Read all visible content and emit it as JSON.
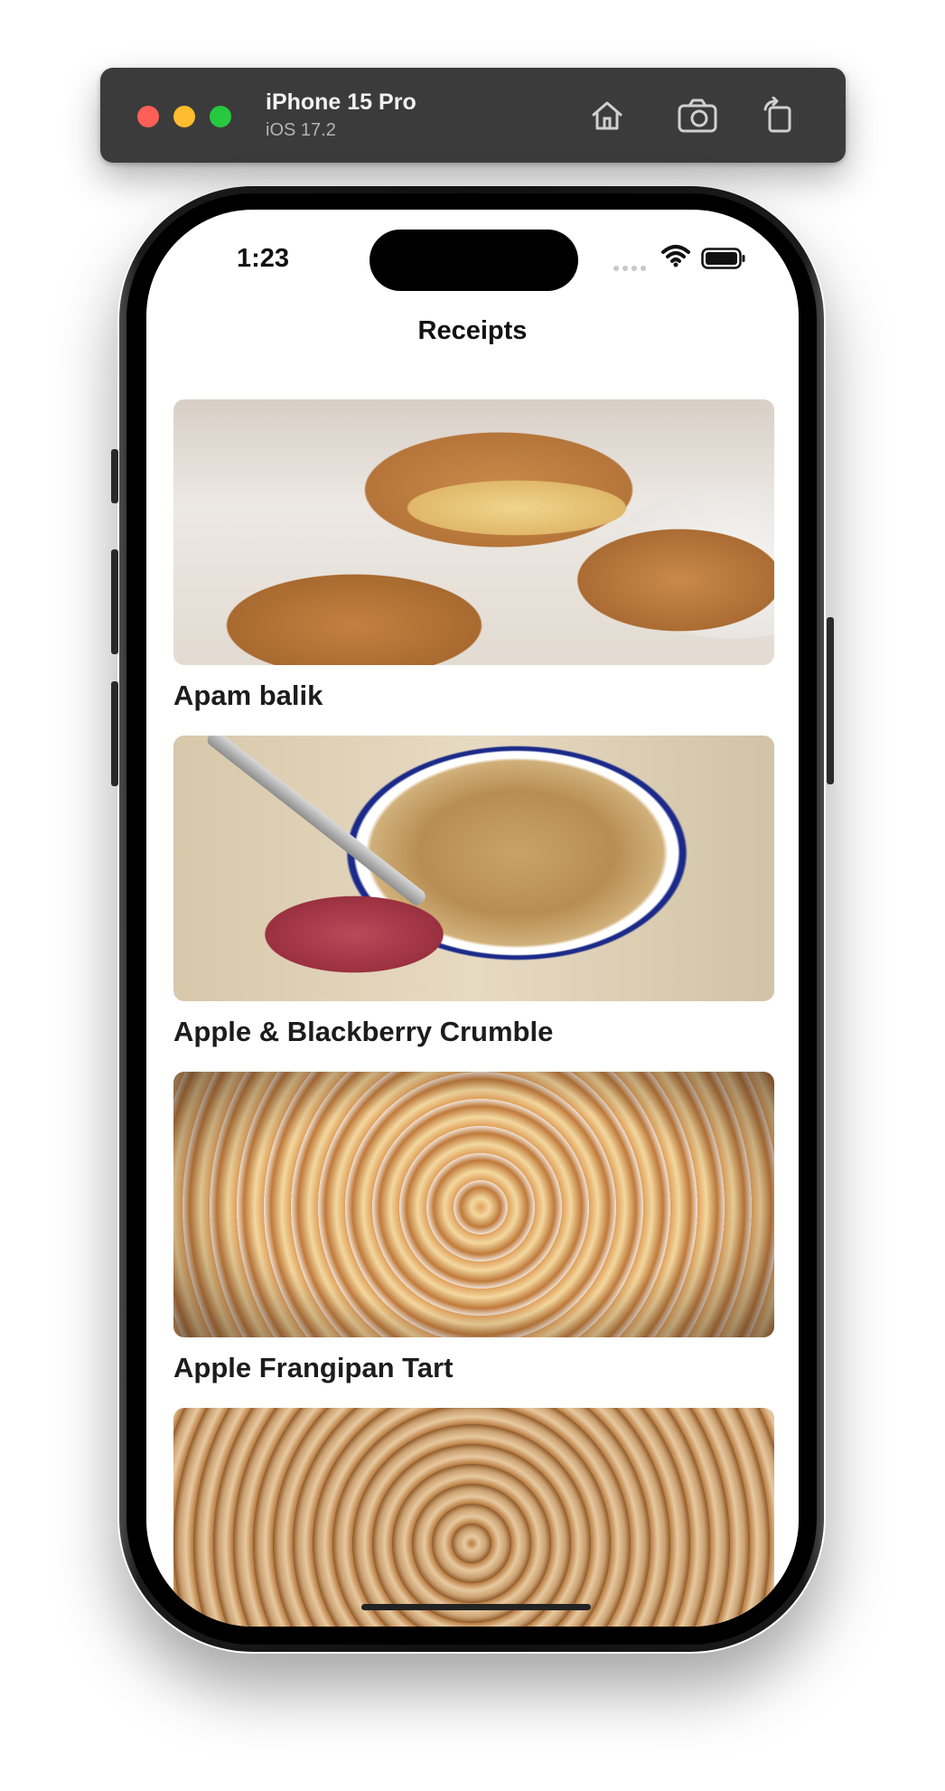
{
  "simulator": {
    "device_name": "iPhone 15 Pro",
    "os_version": "iOS 17.2",
    "toolbar_icons": [
      "home-icon",
      "screenshot-icon",
      "rotate-icon"
    ]
  },
  "status_bar": {
    "time": "1:23",
    "icons": [
      "cellular-dots-icon",
      "wifi-icon",
      "battery-icon"
    ]
  },
  "nav": {
    "title": "Receipts"
  },
  "recipes": [
    {
      "title": "Apam balik"
    },
    {
      "title": "Apple & Blackberry Crumble"
    },
    {
      "title": "Apple Frangipan Tart"
    },
    {
      "title": ""
    }
  ],
  "colors": {
    "toolbar_bg": "#3b3b3b",
    "traffic_red": "#ff5f57",
    "traffic_yellow": "#febc2e",
    "traffic_green": "#28c840",
    "screen_bg": "#ffffff",
    "text": "#1c1c1c"
  }
}
